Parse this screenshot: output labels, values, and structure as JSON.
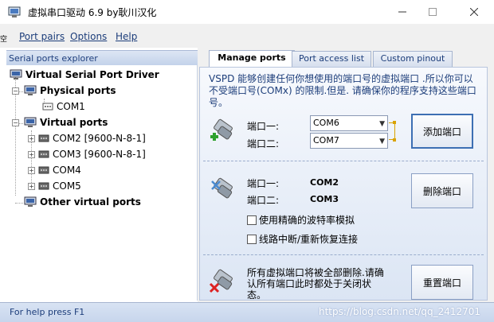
{
  "window": {
    "title": "虚拟串口驱动 6.9 by耿川汉化",
    "app_icon": "serial-port-app-icon",
    "minimize_icon": "minimize-icon",
    "maximize_icon": "maximize-icon",
    "close_icon": "close-icon"
  },
  "edge_mark": "空",
  "menu": {
    "items": [
      {
        "label": "Port pairs"
      },
      {
        "label": "Options"
      },
      {
        "label": "Help"
      }
    ]
  },
  "explorer": {
    "title": "Serial ports explorer",
    "root": "Virtual Serial Port Driver",
    "physical_group": "Physical ports",
    "physical_ports": [
      "COM1"
    ],
    "virtual_group": "Virtual ports",
    "virtual_ports": [
      "COM2 [9600-N-8-1]",
      "COM3 [9600-N-8-1]",
      "COM4",
      "COM5"
    ],
    "other_group": "Other virtual ports"
  },
  "tabs": [
    {
      "label": "Manage ports",
      "active": true
    },
    {
      "label": "Port access list",
      "active": false
    },
    {
      "label": "Custom pinout",
      "active": false
    }
  ],
  "manage": {
    "description": "VSPD 能够创建任何你想使用的端口号的虚拟端口 .所以你可以不受端口号(COMx) 的限制.但是. 请确保你的程序支持这些端口号。",
    "add_section": {
      "port1_label": "端口一:",
      "port2_label": "端口二:",
      "port1_value": "COM6",
      "port2_value": "COM7",
      "button_label": "添加端口"
    },
    "delete_section": {
      "port1_label": "端口一:",
      "port2_label": "端口二:",
      "port1_value": "COM2",
      "port2_value": "COM3",
      "button_label": "删除端口",
      "option_baud": "使用精确的波特率模拟",
      "option_break": "线路中断/重新恢复连接"
    },
    "reset_section": {
      "text": "所有虚拟端口将被全部删除.请确认所有端口此时都处于关闭状态。",
      "button_label": "重置端口"
    }
  },
  "status": {
    "text": "For help press F1",
    "watermark": "https://blog.csdn.net/qq_2412701"
  },
  "colors": {
    "accent": "#1c3d7a",
    "bracket": "#d9a200"
  }
}
